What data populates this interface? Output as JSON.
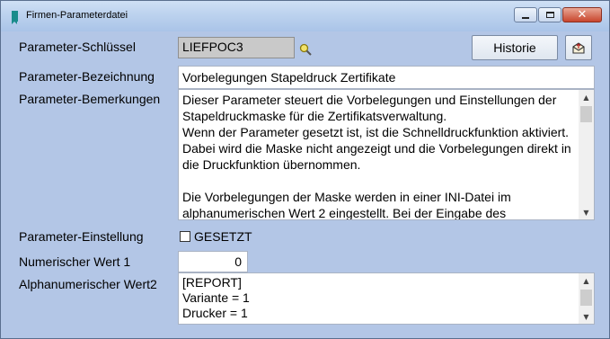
{
  "window": {
    "title": "Firmen-Parameterdatei"
  },
  "form": {
    "schluessel_label": "Parameter-Schlüssel",
    "schluessel_value": "LIEFPOC3",
    "historie_label": "Historie",
    "bezeichnung_label": "Parameter-Bezeichnung",
    "bezeichnung_value": "Vorbelegungen Stapeldruck Zertifikate",
    "bemerkungen_label": "Parameter-Bemerkungen",
    "bemerkungen_value": "Dieser Parameter steuert die Vorbelegungen und Einstellungen der Stapeldruckmaske für die Zertifikatsverwaltung.\nWenn der Parameter gesetzt ist, ist die Schnelldruckfunktion aktiviert. Dabei wird die Maske nicht angezeigt und die Vorbelegungen direkt in die Druckfunktion übernommen.\n\nDie Vorbelegungen der Maske werden in einer INI-Datei im alphanumerischen Wert 2 eingestellt. Bei der Eingabe des individuellen Filters sollte die Hotline kontaktiert werden, da hier bei",
    "einstellung_label": "Parameter-Einstellung",
    "gesetzt_label": "GESETZT",
    "gesetzt_checked": false,
    "num_label": "Numerischer Wert 1",
    "num_value": "0",
    "alpha_label": "Alphanumerischer Wert2",
    "alpha_value": "[REPORT]\nVariante = 1\nDrucker = 1"
  },
  "colors": {
    "window_bg": "#b3c6e6",
    "title_icon": "#1a8c8c",
    "close_button": "#c8452d"
  }
}
